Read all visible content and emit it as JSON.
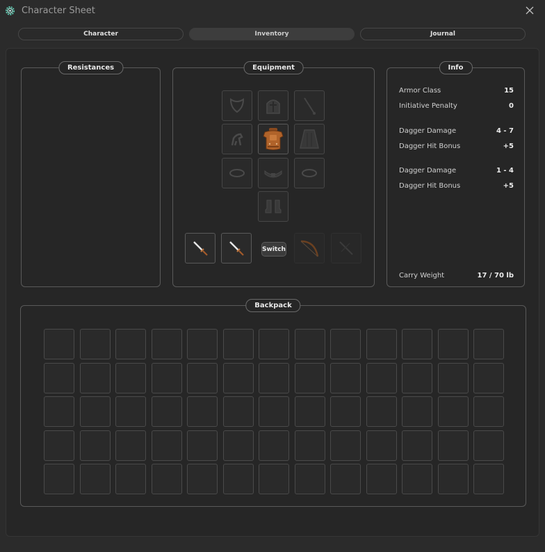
{
  "window": {
    "title": "Character Sheet",
    "icon": "gear-icon",
    "close_icon": "close-icon"
  },
  "tabs": [
    {
      "label": "Character",
      "active": false
    },
    {
      "label": "Inventory",
      "active": true
    },
    {
      "label": "Journal",
      "active": false
    }
  ],
  "panels": {
    "resistances": {
      "label": "Resistances"
    },
    "equipment": {
      "label": "Equipment",
      "switch_label": "Switch",
      "slots": [
        {
          "name": "amulet",
          "icon": "amulet-icon",
          "filled": false
        },
        {
          "name": "helmet",
          "icon": "helmet-icon",
          "filled": false
        },
        {
          "name": "ranged-ammo",
          "icon": "wand-icon",
          "filled": false
        },
        {
          "name": "pet",
          "icon": "creature-icon",
          "filled": false
        },
        {
          "name": "armor",
          "icon": "leather-armor-icon",
          "filled": true
        },
        {
          "name": "cloak",
          "icon": "cloak-icon",
          "filled": false
        },
        {
          "name": "ring-left",
          "icon": "ring-icon",
          "filled": false
        },
        {
          "name": "belt",
          "icon": "belt-icon",
          "filled": false
        },
        {
          "name": "ring-right",
          "icon": "ring-icon",
          "filled": false
        },
        {
          "name": "boots",
          "icon": "boots-icon",
          "filled": false
        }
      ],
      "weapons": [
        {
          "name": "main-hand",
          "icon": "dagger-icon",
          "filled": true
        },
        {
          "name": "off-hand",
          "icon": "dagger-icon",
          "filled": true
        },
        {
          "name": "ranged-main",
          "icon": "bow-icon",
          "filled": false
        },
        {
          "name": "ranged-off",
          "icon": "crossbow-icon",
          "filled": false
        }
      ]
    },
    "info": {
      "label": "Info",
      "rows": [
        {
          "key": "Armor Class",
          "value": "15"
        },
        {
          "key": "Initiative Penalty",
          "value": "0"
        },
        {
          "key": "Dagger Damage",
          "value": "4 - 7"
        },
        {
          "key": "Dagger Hit Bonus",
          "value": "+5"
        },
        {
          "key": "Dagger Damage",
          "value": "1 - 4"
        },
        {
          "key": "Dagger Hit Bonus",
          "value": "+5"
        },
        {
          "key": "Carry Weight",
          "value": "17 / 70 lb"
        }
      ]
    },
    "backpack": {
      "label": "Backpack",
      "rows": 5,
      "cols": 13
    }
  },
  "colors": {
    "background": "#2b2b2b",
    "panel_border": "#5a5a5a",
    "armor_accent": "#b0632a"
  }
}
